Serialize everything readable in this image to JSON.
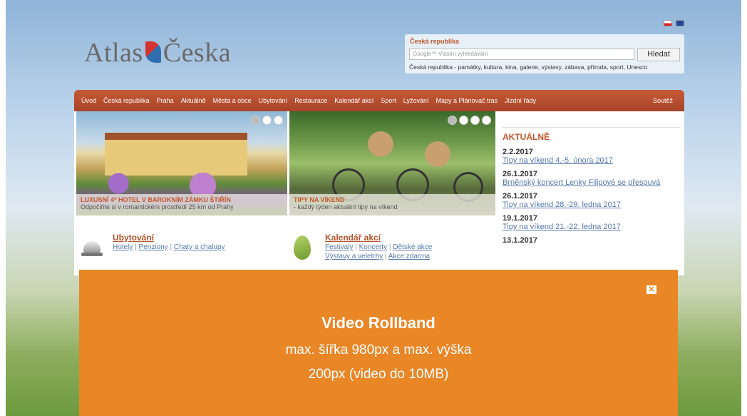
{
  "header": {
    "logo_left": "Atlas",
    "logo_right": "Česka"
  },
  "search": {
    "title": "Česká republika",
    "placeholder": "Google™ Vlastní vyhledávání",
    "button": "Hledat",
    "description": "Česká republika - památky, kultura, kina, galerie, výstavy, zábava, příroda, sport, Unesco"
  },
  "nav": {
    "items": [
      "Úvod",
      "Česká republika",
      "Praha",
      "Aktuálně",
      "Města a obce",
      "Ubytování",
      "Restaurace",
      "Kalendář akcí",
      "Sport",
      "Lyžování",
      "Mapy a Plánovač tras",
      "Jízdní řády"
    ],
    "right": "Soutěž"
  },
  "promos": [
    {
      "title": "LUXUSNÍ 4* HOTEL V BAROKNÍM ZÁMKU ŠTIŘÍN",
      "subtitle": "Odpočiňte si v romantickém prostředí 25 km od Prahy"
    },
    {
      "title": "TIPY NA VÍKEND",
      "subtitle": "- každý týden aktuální tipy na víkend"
    }
  ],
  "aktualne": {
    "title": "AKTUÁLNĚ",
    "items": [
      {
        "date": "2.2.2017",
        "link": "Tipy na víkend 4.-5. února 2017"
      },
      {
        "date": "26.1.2017",
        "link": "Brněnský koncert Lenky Filipové se přesouvá"
      },
      {
        "date": "26.1.2017",
        "link": "Tipy na víkend 28.-29. ledna 2017"
      },
      {
        "date": "19.1.2017",
        "link": "Tipy na víkend 21.-22. ledna 2017"
      },
      {
        "date": "13.1.2017",
        "link": ""
      }
    ]
  },
  "sections": {
    "ubytovani": {
      "title": "Ubytování",
      "links": [
        "Hotely",
        "Penziony",
        "Chaty a chalupy"
      ]
    },
    "kalendar": {
      "title": "Kalendář akcí",
      "links_row1": [
        "Festivaly",
        "Koncerty",
        "Dětské akce"
      ],
      "links_row2": [
        "Výstavy a veletrhy",
        "Akce zdarma"
      ]
    }
  },
  "rollband": {
    "title": "Video Rollband",
    "line1": "max. šířka 980px a max. výška",
    "line2": "200px (video do 10MB)",
    "close_icon": "close-icon"
  },
  "colors": {
    "nav": "#b34d2e",
    "accent": "#c4572a",
    "rollband": "#e98626",
    "link": "#5577aa"
  }
}
